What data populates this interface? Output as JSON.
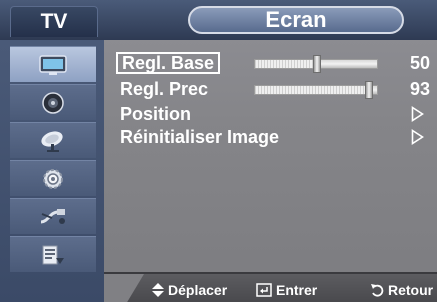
{
  "header": {
    "tv_label": "TV",
    "title": "Ecran"
  },
  "sidebar": {
    "items": [
      {
        "icon": "picture-icon",
        "active": true
      },
      {
        "icon": "sound-icon",
        "active": false
      },
      {
        "icon": "satellite-dish-icon",
        "active": false
      },
      {
        "icon": "settings-gear-icon",
        "active": false
      },
      {
        "icon": "input-plug-icon",
        "active": false
      },
      {
        "icon": "application-icon",
        "active": false
      }
    ]
  },
  "menu": {
    "items": [
      {
        "label": "Regl. Base",
        "value": "50",
        "level": 0.5,
        "selected": true
      },
      {
        "label": "Regl. Prec",
        "value": "93",
        "level": 0.93,
        "selected": false
      },
      {
        "label": "Position",
        "selected": false
      },
      {
        "label": "Réinitialiser Image",
        "selected": false
      }
    ]
  },
  "footer": {
    "move": "Déplacer",
    "enter": "Entrer",
    "return": "Retour"
  },
  "colors": {
    "background": "#86868a",
    "header_bar": "#2e3a53",
    "sidebar": "#4a5a78",
    "text": "#ffffff"
  }
}
